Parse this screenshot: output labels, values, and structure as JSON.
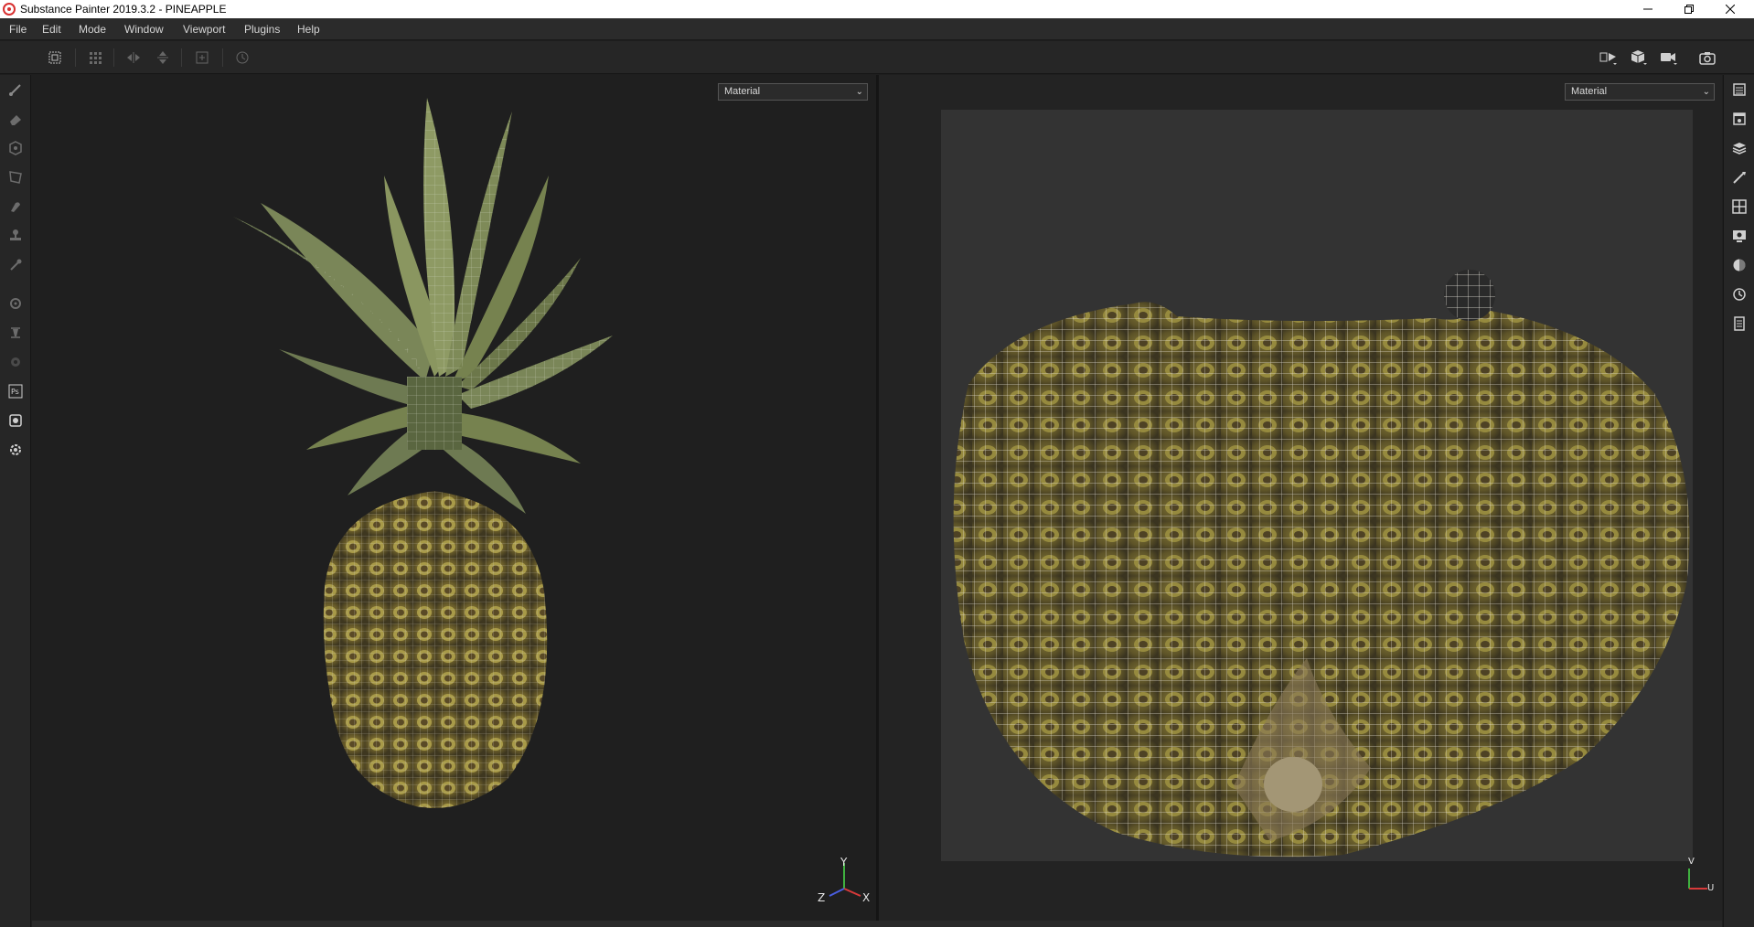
{
  "window": {
    "title": "Substance Painter 2019.3.2 - PINEAPPLE"
  },
  "menu": {
    "items": [
      "File",
      "Edit",
      "Mode",
      "Window",
      "Viewport",
      "Plugins",
      "Help"
    ]
  },
  "toolbar": {
    "left_icons": [
      "uv-tiles-icon",
      "grid-icon",
      "mirror-x-icon",
      "mirror-y-icon",
      "add-icon",
      "history-icon"
    ],
    "right_icons": [
      "viewport-split-icon",
      "cube-display-icon",
      "camera-icon",
      "screenshot-icon"
    ]
  },
  "tools": {
    "left": [
      "paint-brush-icon",
      "eraser-icon",
      "projection-icon",
      "polygon-fill-icon",
      "smudge-icon",
      "clone-stamp-icon",
      "color-picker-icon",
      "bake-icon",
      "iray-icon",
      "plugin-icon",
      "photoshop-export-icon",
      "resources-icon",
      "settings-icon"
    ],
    "left_extra_label": "Ps",
    "right": [
      "texture-set-list-icon",
      "texture-set-settings-icon",
      "layers-icon",
      "properties-icon",
      "display-settings-icon",
      "viewer-settings-icon",
      "shader-settings-icon",
      "history-panel-icon",
      "log-icon"
    ]
  },
  "viewport3d": {
    "mode_select": "Material",
    "axis": {
      "y": "Y",
      "z": "Z",
      "x": "X"
    }
  },
  "viewport2d": {
    "mode_select": "Material",
    "axis": {
      "v": "V",
      "u": "U"
    }
  },
  "colors": {
    "accent_red": "#e03030",
    "axis_x": "#d83a3a",
    "axis_y": "#3fb03f",
    "axis_z": "#4a5ee0"
  }
}
